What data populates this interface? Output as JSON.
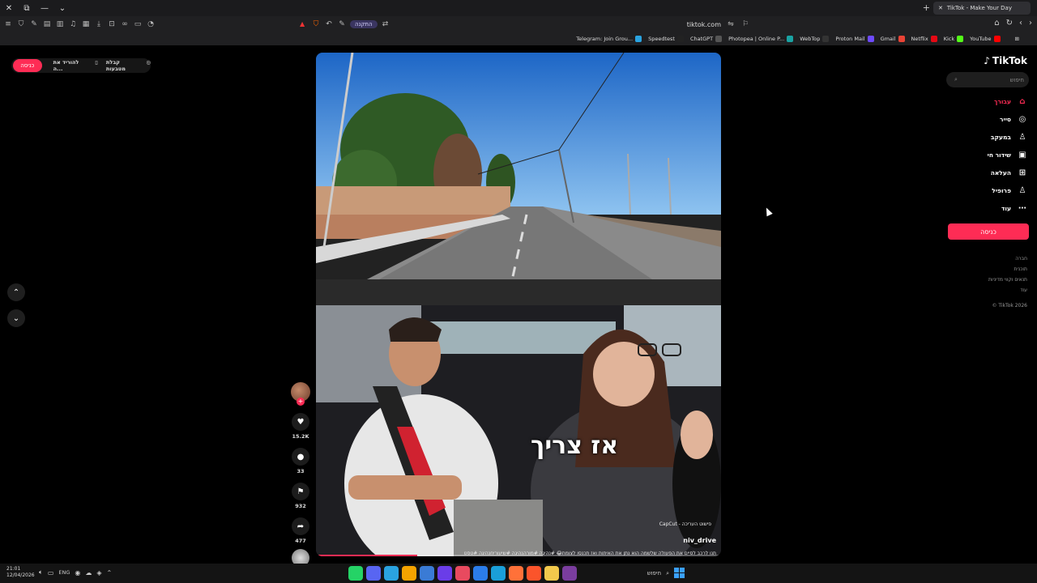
{
  "browser": {
    "tab_title": "TikTok - Make Your Day",
    "url": "tiktok.com",
    "pill_label": "התקנה",
    "bookmarks": [
      {
        "label": "Telegram: Join Grou...",
        "color": "#2aa3e0"
      },
      {
        "label": "Speedtest",
        "color": "#222"
      },
      {
        "label": "ChatGPT",
        "color": "#555"
      },
      {
        "label": "Photopea | Online P...",
        "color": "#1aa3a3"
      },
      {
        "label": "WebTop",
        "color": "#333"
      },
      {
        "label": "Proton Mail",
        "color": "#6d4aff"
      },
      {
        "label": "Gmail",
        "color": "#ea4335"
      },
      {
        "label": "Netflix",
        "color": "#e50914"
      },
      {
        "label": "Kick",
        "color": "#53fc18"
      },
      {
        "label": "YouTube",
        "color": "#ff0000"
      }
    ]
  },
  "top_bar": {
    "login_label": "כניסה",
    "download_label": "להוריד את ה...",
    "coins_label": "קבלת מטבעות"
  },
  "video": {
    "overlay_text": "אז צריך",
    "capcut_label": "CapCut - פישוט העריכה",
    "username": "niv_drive",
    "caption": "תנו לרכב לסיים את הפעולה שלשמה הוא נתן את האיתות ואז תכנסו לצומת😂 #נהיגה #מורהנהיגה #שיעוריחנהיגה #טסט",
    "progress_pct": 25
  },
  "actions": {
    "likes": "15.2K",
    "comments": "33",
    "saves": "932",
    "shares": "477"
  },
  "sidebar": {
    "logo": "TikTok",
    "search_placeholder": "חיפוש",
    "items": [
      {
        "label": "עבורך",
        "icon": "home-icon",
        "glyph": "⌂",
        "active": true
      },
      {
        "label": "סייר",
        "icon": "compass-icon",
        "glyph": "◎"
      },
      {
        "label": "במעקב",
        "icon": "following-icon",
        "glyph": "♙"
      },
      {
        "label": "שידור חי",
        "icon": "live-icon",
        "glyph": "▣"
      },
      {
        "label": "העלאה",
        "icon": "upload-icon",
        "glyph": "⊞"
      },
      {
        "label": "פרופיל",
        "icon": "profile-icon",
        "glyph": "♙"
      },
      {
        "label": "עוד",
        "icon": "more-icon",
        "glyph": "⋯"
      }
    ],
    "login_label": "כניסה",
    "footer": [
      "חברה",
      "תוכנית",
      "תנאים וקווי מדיניות",
      "עוד",
      "© TikTok 2026"
    ]
  },
  "taskbar": {
    "time": "21:01",
    "date": "12/04/2026",
    "lang": "ENG",
    "search_label": "חיפוש"
  },
  "colors": {
    "accent": "#fe2c55",
    "page_bg": "#000000"
  }
}
